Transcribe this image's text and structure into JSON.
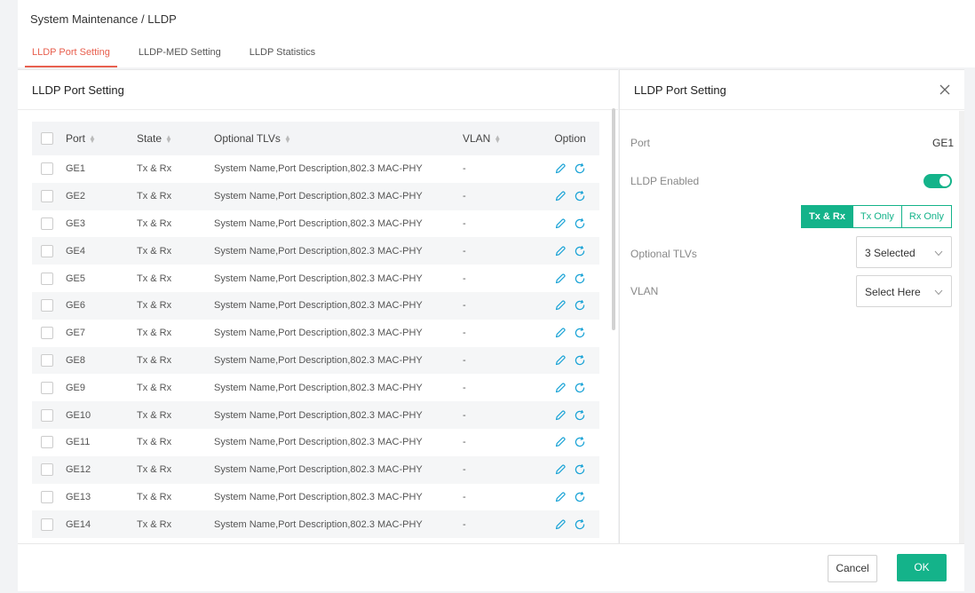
{
  "breadcrumb": "System Maintenance / LLDP",
  "tabs": [
    {
      "label": "LLDP Port Setting"
    },
    {
      "label": "LLDP-MED Setting"
    },
    {
      "label": "LLDP Statistics"
    }
  ],
  "left_panel": {
    "title": "LLDP Port Setting",
    "columns": {
      "port": "Port",
      "state": "State",
      "tlvs": "Optional TLVs",
      "vlan": "VLAN",
      "option": "Option"
    },
    "rows": [
      {
        "port": "GE1",
        "state": "Tx & Rx",
        "tlvs": "System Name,Port Description,802.3 MAC-PHY",
        "vlan": "-"
      },
      {
        "port": "GE2",
        "state": "Tx & Rx",
        "tlvs": "System Name,Port Description,802.3 MAC-PHY",
        "vlan": "-"
      },
      {
        "port": "GE3",
        "state": "Tx & Rx",
        "tlvs": "System Name,Port Description,802.3 MAC-PHY",
        "vlan": "-"
      },
      {
        "port": "GE4",
        "state": "Tx & Rx",
        "tlvs": "System Name,Port Description,802.3 MAC-PHY",
        "vlan": "-"
      },
      {
        "port": "GE5",
        "state": "Tx & Rx",
        "tlvs": "System Name,Port Description,802.3 MAC-PHY",
        "vlan": "-"
      },
      {
        "port": "GE6",
        "state": "Tx & Rx",
        "tlvs": "System Name,Port Description,802.3 MAC-PHY",
        "vlan": "-"
      },
      {
        "port": "GE7",
        "state": "Tx & Rx",
        "tlvs": "System Name,Port Description,802.3 MAC-PHY",
        "vlan": "-"
      },
      {
        "port": "GE8",
        "state": "Tx & Rx",
        "tlvs": "System Name,Port Description,802.3 MAC-PHY",
        "vlan": "-"
      },
      {
        "port": "GE9",
        "state": "Tx & Rx",
        "tlvs": "System Name,Port Description,802.3 MAC-PHY",
        "vlan": "-"
      },
      {
        "port": "GE10",
        "state": "Tx & Rx",
        "tlvs": "System Name,Port Description,802.3 MAC-PHY",
        "vlan": "-"
      },
      {
        "port": "GE11",
        "state": "Tx & Rx",
        "tlvs": "System Name,Port Description,802.3 MAC-PHY",
        "vlan": "-"
      },
      {
        "port": "GE12",
        "state": "Tx & Rx",
        "tlvs": "System Name,Port Description,802.3 MAC-PHY",
        "vlan": "-"
      },
      {
        "port": "GE13",
        "state": "Tx & Rx",
        "tlvs": "System Name,Port Description,802.3 MAC-PHY",
        "vlan": "-"
      },
      {
        "port": "GE14",
        "state": "Tx & Rx",
        "tlvs": "System Name,Port Description,802.3 MAC-PHY",
        "vlan": "-"
      }
    ]
  },
  "right_panel": {
    "title": "LLDP Port Setting",
    "port_label": "Port",
    "port_value": "GE1",
    "lldp_enabled_label": "LLDP Enabled",
    "lldp_enabled": true,
    "mode_options": [
      "Tx & Rx",
      "Tx Only",
      "Rx Only"
    ],
    "mode_selected": "Tx & Rx",
    "tlvs_label": "Optional TLVs",
    "tlvs_value": "3 Selected",
    "vlan_label": "VLAN",
    "vlan_value": "Select Here"
  },
  "footer": {
    "cancel_label": "Cancel",
    "ok_label": "OK"
  },
  "colors": {
    "accent": "#14b38a",
    "active_tab": "#e8604f",
    "icon_blue": "#1aa3d6"
  }
}
